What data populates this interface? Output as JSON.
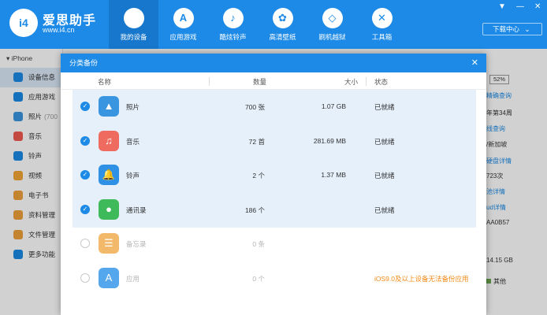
{
  "app": {
    "logo_text": "i4",
    "brand": "爱思助手",
    "url": "www.i4.cn"
  },
  "nav": [
    {
      "label": "我的设备",
      "icon": "apple-icon",
      "glyph": "",
      "active": true
    },
    {
      "label": "应用游戏",
      "icon": "appstore-icon",
      "glyph": "A"
    },
    {
      "label": "酷炫铃声",
      "icon": "bell-icon",
      "glyph": "♪"
    },
    {
      "label": "高清壁纸",
      "icon": "flower-icon",
      "glyph": "✿"
    },
    {
      "label": "刷机越狱",
      "icon": "box-icon",
      "glyph": "◇"
    },
    {
      "label": "工具箱",
      "icon": "wrench-icon",
      "glyph": "✕"
    }
  ],
  "window": {
    "download_center": "下载中心",
    "download_arrow": "⌄"
  },
  "sidebar": {
    "root": "iPhone",
    "items": [
      {
        "label": "设备信息",
        "color": "#1c8ae6",
        "active": true
      },
      {
        "label": "应用游戏",
        "color": "#1c8ae6"
      },
      {
        "label": "照片",
        "count": "(700",
        "color": "#3a95e0"
      },
      {
        "label": "音乐",
        "color": "#ef5a4f"
      },
      {
        "label": "铃声",
        "color": "#1c8ae6"
      },
      {
        "label": "视频",
        "color": "#f3a536"
      },
      {
        "label": "电子书",
        "color": "#f0a23a"
      },
      {
        "label": "资料管理",
        "color": "#f0a23a"
      },
      {
        "label": "文件管理",
        "color": "#f0a23a"
      },
      {
        "label": "更多功能",
        "color": "#1c8ae6"
      }
    ]
  },
  "right_panel": {
    "battery": "52%",
    "lines": [
      {
        "text": "精确查询",
        "link": true
      },
      {
        "text": "年第34周",
        "link": false
      },
      {
        "text": "线查询",
        "link": true
      },
      {
        "text": "/新加坡",
        "link": false
      },
      {
        "text": "硬盘详情",
        "link": true
      },
      {
        "text": "723次",
        "link": false
      },
      {
        "text": "池详情",
        "link": true
      },
      {
        "text": "ud详情",
        "link": true
      },
      {
        "text": "AA0B57",
        "link": false
      }
    ],
    "storage": "14.15 GB",
    "legend": "其他"
  },
  "modal": {
    "title": "分类备份",
    "close": "✕",
    "columns": {
      "name": "名称",
      "count": "数量",
      "size": "大小",
      "status": "状态"
    },
    "rows": [
      {
        "name": "照片",
        "count": "700 张",
        "size": "1.07 GB",
        "status": "已就绪",
        "checked": true,
        "icon": "photos-icon",
        "glyph": "▲",
        "icon_color": "#3a95e0"
      },
      {
        "name": "音乐",
        "count": "72 首",
        "size": "281.69 MB",
        "status": "已就绪",
        "checked": true,
        "icon": "music-icon",
        "glyph": "♫",
        "icon_color": "#ef6a5f"
      },
      {
        "name": "铃声",
        "count": "2 个",
        "size": "1.37 MB",
        "status": "已就绪",
        "checked": true,
        "icon": "bell-icon",
        "glyph": "🔔",
        "icon_color": "#2f91e6"
      },
      {
        "name": "通讯录",
        "count": "186 个",
        "size": "",
        "status": "已就绪",
        "checked": true,
        "icon": "contacts-icon",
        "glyph": "●",
        "icon_color": "#3fba5a"
      },
      {
        "name": "备忘录",
        "count": "0 条",
        "size": "",
        "status": "",
        "checked": false,
        "icon": "notes-icon",
        "glyph": "☰",
        "icon_color": "#f0a23a"
      },
      {
        "name": "应用",
        "count": "0 个",
        "size": "",
        "status": "iOS9.0及以上设备无法备份应用",
        "checked": false,
        "warn": true,
        "icon": "appstore-icon",
        "glyph": "A",
        "icon_color": "#1c8ae6"
      }
    ]
  }
}
